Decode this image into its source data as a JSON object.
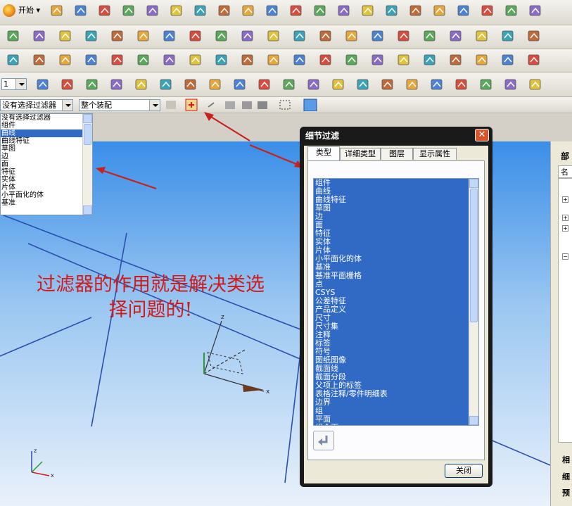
{
  "toolbar": {
    "start_label": "开始",
    "row1_icons": [
      "new-file-icon",
      "open-folder-icon",
      "save-icon",
      "undo-icon",
      "redo-icon",
      "edit-icon",
      "copy-icon",
      "info-icon",
      "fit-view-icon",
      "zoom-region-icon",
      "zoom-icon",
      "zoom-in-icon",
      "rotate-icon",
      "pan-icon",
      "view-icon",
      "cube-icon",
      "studio-icon",
      "shaded-icon",
      "wireframe-icon",
      "sketch-icon",
      "display-box-icon"
    ],
    "row2_icons": [
      "book-icon",
      "extrude-icon",
      "revolve-icon",
      "sweep-icon",
      "datum-icon",
      "measure-icon",
      "line-icon",
      "arc-icon",
      "text-icon",
      "plus-icon",
      "corner-icon",
      "polygon-icon",
      "circle-icon",
      "spline-icon",
      "curve-icon",
      "project-icon",
      "tangent-icon",
      "surface-icon",
      "mesh-icon",
      "trim-icon",
      "offset-icon"
    ],
    "row3_icons": [
      "point-icon",
      "rect-icon",
      "block-icon",
      "cylinder-icon",
      "cone-icon",
      "sphere-icon",
      "boolean-icon",
      "hole-icon",
      "boss-icon",
      "pocket-icon",
      "slot-icon",
      "groove-icon",
      "pad-icon",
      "assembly-icon",
      "mate-icon",
      "explode-icon",
      "blend-icon",
      "chamfer-icon",
      "shell-icon",
      "draft-icon",
      "xform-icon"
    ],
    "row4_icons": [
      "csys-icon",
      "csys-origin-icon",
      "csys-3point-icon",
      "csys-dynamic-icon",
      "csys-offset-icon",
      "csys-absolute-icon",
      "csys-xc-icon",
      "csys-yc-icon",
      "csys-save-icon",
      "run-icon",
      "play-icon",
      "component-icon",
      "move-icon",
      "replace-icon",
      "constraint-icon",
      "reference-icon",
      "layer-icon",
      "hide-icon",
      "show-icon",
      "wave-icon",
      "checker-icon"
    ],
    "layer_value": "1",
    "filter_selected": "没有选择过滤器",
    "scope_selected": "整个装配"
  },
  "filter_list": {
    "items": [
      "没有选择过滤器",
      "组件",
      "曲线",
      "曲线特征",
      "草图",
      "边",
      "面",
      "特征",
      "实体",
      "片体",
      "小平面化的体",
      "基准"
    ],
    "selected_index": 2
  },
  "annotation": {
    "line1": "过滤器的作用就是解决类选",
    "line2": "择问题的!"
  },
  "dialog": {
    "title": "细节过滤",
    "close_symbol": "✕",
    "tabs": [
      "类型",
      "详细类型",
      "图层",
      "显示属性"
    ],
    "active_tab": 0,
    "types": [
      "组件",
      "曲线",
      "曲线特征",
      "草图",
      "边",
      "面",
      "特征",
      "实体",
      "片体",
      "小平面化的体",
      "基准",
      "基准平面栅格",
      "点",
      "CSYS",
      "公差特征",
      "产品定义",
      "尺寸",
      "尺寸集",
      "注释",
      "标签",
      "符号",
      "图纸图像",
      "截面线",
      "截面分段",
      "父项上的标签",
      "表格注释/零件明细表",
      "边界",
      "组",
      "平面",
      "组合面"
    ],
    "close_button": "关闭"
  },
  "right_panel": {
    "title_partial": "部",
    "header_partial": "名",
    "bottom_items": [
      "相",
      "细",
      "预"
    ]
  },
  "colors": {
    "accent_red": "#d21a1a",
    "selection_blue": "#316ac5"
  }
}
